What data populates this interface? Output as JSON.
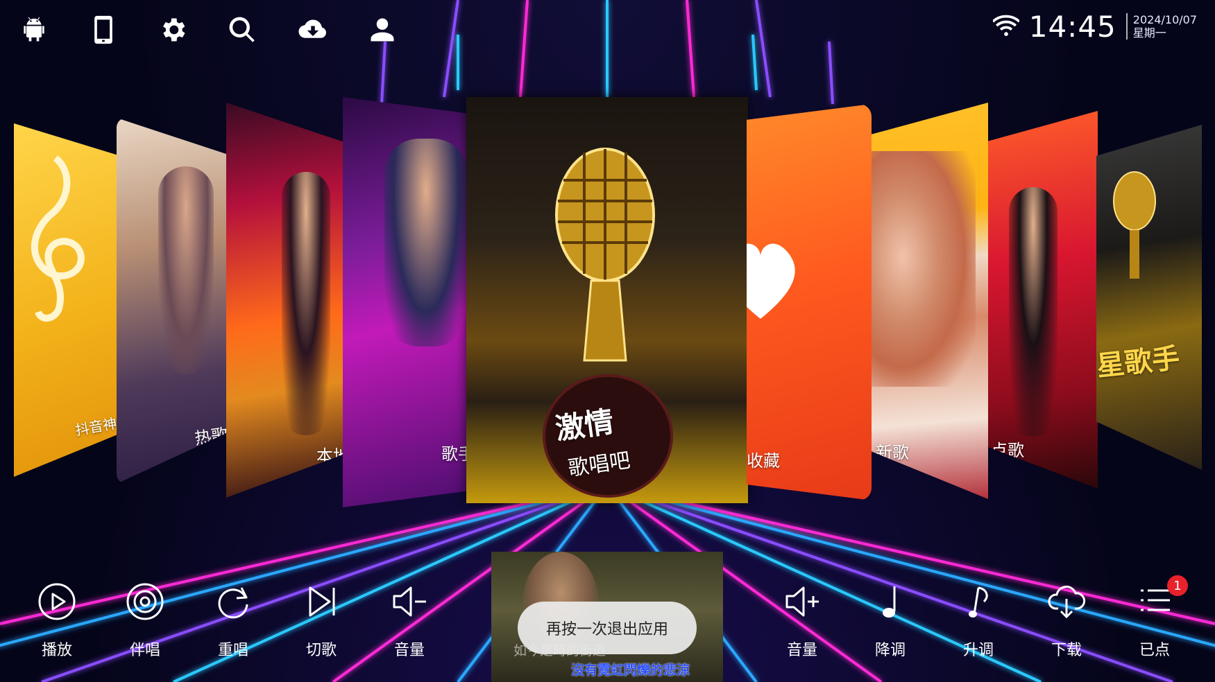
{
  "status_bar": {
    "time": "14:45",
    "date": "2024/10/07",
    "weekday": "星期一",
    "wifi_icon": "wifi-icon"
  },
  "top_icons": [
    "android-icon",
    "phone-icon",
    "settings-icon",
    "search-icon",
    "cloud-download-icon",
    "user-icon"
  ],
  "carousel": {
    "cards": [
      {
        "label": "抖音神曲"
      },
      {
        "label": "热歌"
      },
      {
        "label": "本地"
      },
      {
        "label": "歌手"
      },
      {
        "title": "激情",
        "subtitle": "歌唱吧"
      },
      {
        "label": "收藏"
      },
      {
        "label": "新歌"
      },
      {
        "label": "点歌"
      },
      {
        "label": "星歌手"
      }
    ]
  },
  "video_preview": {
    "lyric_previous": "如今是時的街道",
    "lyric_current": "沒有霓虹閃爍的悲涼"
  },
  "toast": "再按一次退出应用",
  "controls": [
    {
      "label": "播放",
      "icon": "play-icon"
    },
    {
      "label": "伴唱",
      "icon": "accompany-icon"
    },
    {
      "label": "重唱",
      "icon": "replay-icon"
    },
    {
      "label": "切歌",
      "icon": "skip-icon"
    },
    {
      "label": "音量",
      "icon": "volume-down-icon"
    },
    {
      "label": "音量",
      "icon": "volume-up-icon"
    },
    {
      "label": "降调",
      "icon": "pitch-down-icon"
    },
    {
      "label": "升调",
      "icon": "pitch-up-icon"
    },
    {
      "label": "下载",
      "icon": "download-icon"
    },
    {
      "label": "已点",
      "icon": "queue-icon"
    }
  ],
  "queue_badge": "1",
  "colors": {
    "neon_pink": "#ff2bd6",
    "neon_blue": "#29c9ff",
    "neon_purple": "#8a4dff",
    "badge": "#e8222b"
  }
}
